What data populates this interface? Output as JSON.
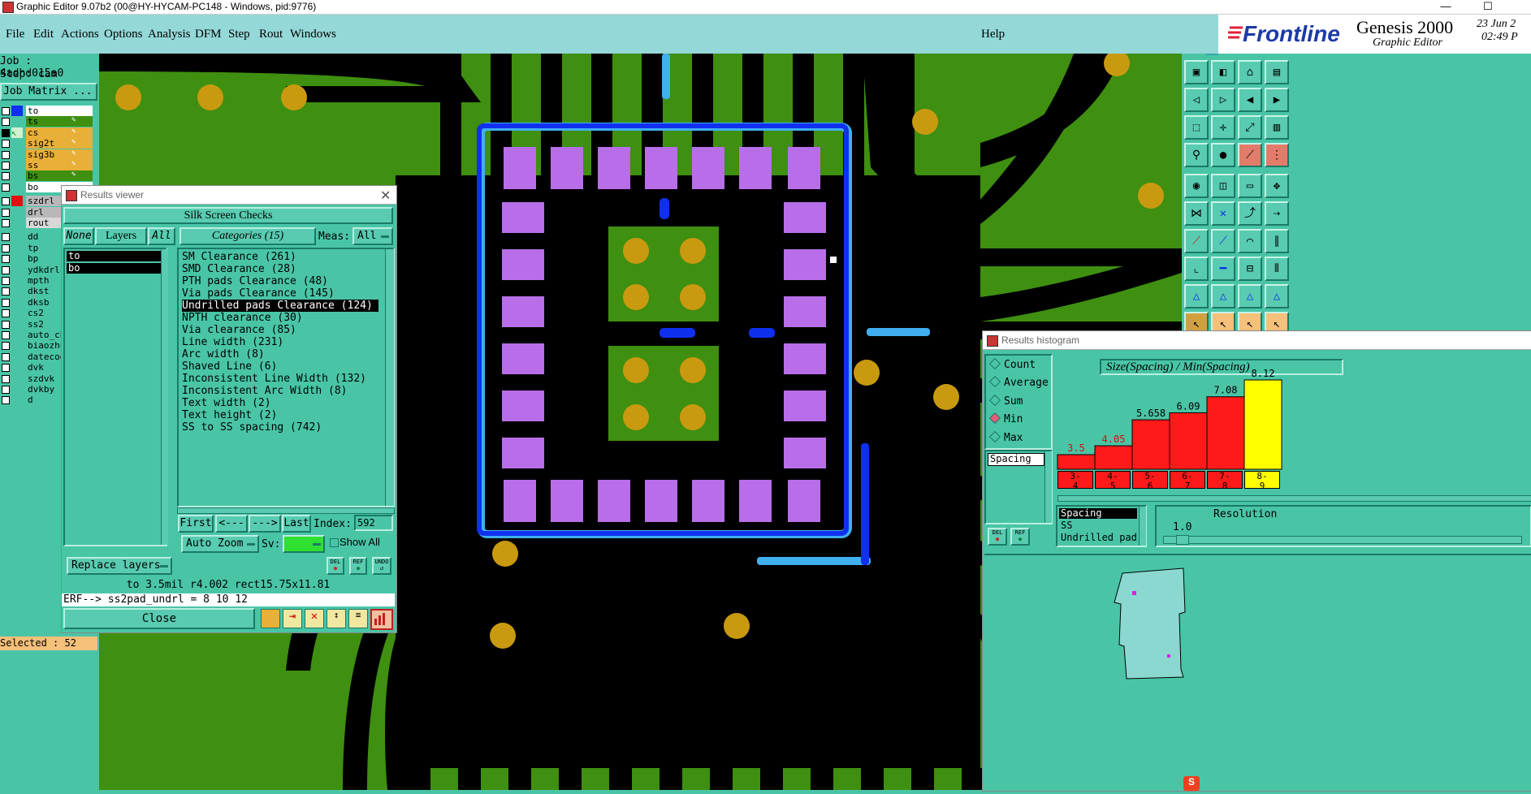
{
  "window": {
    "title": "Graphic Editor 9.07b2 (00@HY-HYCAM-PC148 - Windows, pid:9776)",
    "minimize": "—",
    "maximize": "☐"
  },
  "menu": {
    "items": [
      "File",
      "Edit",
      "Actions",
      "Options",
      "Analysis",
      "DFM",
      "Step",
      "Rout",
      "Windows"
    ],
    "help": "Help"
  },
  "logo": {
    "brand": "Frontline",
    "product": "Genesis 2000",
    "subtitle": "Graphic Editor",
    "date": "23 Jun 2",
    "time": "02:49 P",
    "brand_color": "#1c3aa6",
    "accent_color": "#e0203a"
  },
  "job": {
    "job_label": "Job : 4adhd015a0",
    "step_label": "Step: cam",
    "matrix_button": "Job Matrix ...",
    "selected_label": "Selected : 52"
  },
  "layers": [
    {
      "name": "to",
      "swatch": "#1030f0",
      "state": "on"
    },
    {
      "name": "ts",
      "swatch": "",
      "state": "board"
    },
    {
      "name": "cs",
      "swatch": "",
      "state": "sel"
    },
    {
      "name": "sig2t",
      "swatch": "",
      "state": "sel"
    },
    {
      "name": "sig3b",
      "swatch": "",
      "state": "sel"
    },
    {
      "name": "ss",
      "swatch": "",
      "state": "sel"
    },
    {
      "name": "bs",
      "swatch": "",
      "state": "board"
    },
    {
      "name": "bo",
      "swatch": "",
      "state": "on"
    },
    {
      "name": "szdrl",
      "swatch": "#e01010",
      "state": "gray"
    },
    {
      "name": "drl",
      "swatch": "",
      "state": "gray"
    },
    {
      "name": "rout",
      "swatch": "",
      "state": "gray2"
    },
    {
      "name": "dd",
      "swatch": "",
      "state": "none"
    },
    {
      "name": "tp",
      "swatch": "",
      "state": "none"
    },
    {
      "name": "bp",
      "swatch": "",
      "state": "none"
    },
    {
      "name": "ydkdrl",
      "swatch": "",
      "state": "none"
    },
    {
      "name": "mpth",
      "swatch": "",
      "state": "none"
    },
    {
      "name": "dkst",
      "swatch": "",
      "state": "none"
    },
    {
      "name": "dksb",
      "swatch": "",
      "state": "none"
    },
    {
      "name": "cs2",
      "swatch": "",
      "state": "none"
    },
    {
      "name": "ss2",
      "swatch": "",
      "state": "none"
    },
    {
      "name": "auto_chk",
      "swatch": "",
      "state": "none"
    },
    {
      "name": "biaozhu",
      "swatch": "",
      "state": "none"
    },
    {
      "name": "datecode",
      "swatch": "",
      "state": "none"
    },
    {
      "name": "dvk",
      "swatch": "",
      "state": "none"
    },
    {
      "name": "szdvk",
      "swatch": "",
      "state": "none"
    },
    {
      "name": "dvkby",
      "swatch": "",
      "state": "none"
    },
    {
      "name": "d",
      "swatch": "",
      "state": "none"
    }
  ],
  "results_viewer": {
    "title": "Results viewer",
    "header": "Silk Screen Checks",
    "none_btn": "None",
    "layers_btn": "Layers",
    "all_btn": "All",
    "layer_list": [
      "to",
      "bo"
    ],
    "categories_btn": "Categories (15)",
    "meas_label": "Meas:",
    "meas_value": "All",
    "categories": [
      "SM Clearance (261)",
      "SMD Clearance (28)",
      "PTH pads Clearance (48)",
      "Via pads Clearance (145)",
      "Undrilled pads Clearance (124)",
      "NPTH clearance (30)",
      "Via clearance (85)",
      "Line width (231)",
      "Arc width (8)",
      "Shaved Line (6)",
      "Inconsistent Line Width (132)",
      "Inconsistent Arc Width (8)",
      "Text width (2)",
      "Text height (2)",
      "SS to SS spacing (742)"
    ],
    "selected_category": 4,
    "first_btn": "First",
    "prev_btn": "<---",
    "next_btn": "--->",
    "last_btn": "Last",
    "index_label": "Index:",
    "index_value": "592",
    "auto_zoom": "Auto Zoom",
    "sv_label": "Sv:",
    "show_all": "Show All",
    "replace_layers": "Replace layers",
    "del_btn": "DEL",
    "ref_btn": "REF",
    "undo_btn": "UNDO",
    "info_line": "to 3.5mil  r4.002  rect15.75x11.81",
    "erf_line": "ERF--> ss2pad_undrl = 8 10 12",
    "close_btn": "Close"
  },
  "histogram": {
    "title": "Results histogram",
    "modes": [
      "Count",
      "Average",
      "Sum",
      "Min",
      "Max"
    ],
    "active_mode": "Min",
    "measure_label": "Spacing",
    "header": "Size(Spacing) / Min(Spacing)",
    "spacing_list": [
      "Spacing",
      "SS",
      "Undrilled pad"
    ],
    "resolution_label": "Resolution",
    "resolution_value": "1.0",
    "del_btn": "DEL",
    "ref_btn": "REF"
  },
  "chart_data": {
    "type": "bar",
    "categories": [
      "3-4",
      "4-5",
      "5-6",
      "6-7",
      "7-8",
      "8-9"
    ],
    "values": [
      3.5,
      4.05,
      5.658,
      6.09,
      7.08,
      8.12
    ],
    "value_labels": [
      "3.5",
      "4.05",
      "5.658",
      "6.09",
      "7.08",
      "8.12"
    ],
    "title": "Size(Spacing) / Min(Spacing)",
    "colors": {
      "bar": "#ff1a1a",
      "highlight": "#ffff00",
      "label_red": "#d01010"
    }
  },
  "pcb_colors": {
    "board": "#000000",
    "copper": "#3f8f10",
    "pad": "#b86ee8",
    "silk": "#1030f0",
    "silk_light": "#40b0f0",
    "drill": "#c99a10"
  }
}
